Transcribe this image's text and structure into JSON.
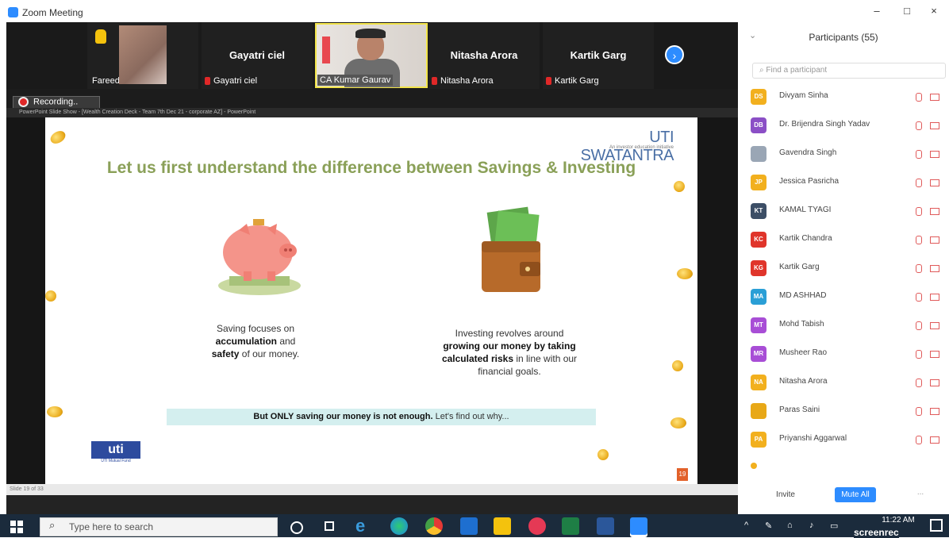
{
  "window": {
    "title": "Zoom Meeting",
    "minimize": "–",
    "maximize": "□",
    "close": "×"
  },
  "meeting": {
    "tiles": [
      {
        "label": "Fareed Fareed"
      },
      {
        "name": "Gayatri ciel",
        "label": "Gayatri ciel"
      },
      {
        "label": "CA Kumar Gaurav"
      },
      {
        "name": "Nitasha Arora",
        "label": "Nitasha Arora"
      },
      {
        "name": "Kartik Garg",
        "label": "Kartik Garg"
      }
    ],
    "next": "›",
    "recording": "Recording..",
    "ppt_bar": "PowerPoint Slide Show - [Wealth Creation Deck - Team 7th Dec 21 - corporate AZ] - PowerPoint",
    "status": "Slide 19 of 33"
  },
  "slide": {
    "brand": "UTI SWATANTRA",
    "brand_sub": "An investor education initiative",
    "title": "Let us first understand the difference between Savings & Investing",
    "saving_1": "Saving focuses on",
    "saving_2": "accumulation",
    "saving_3": "and",
    "saving_4": "safety",
    "saving_5": "of our money.",
    "invest_1": "Investing revolves around",
    "invest_2": "growing our money by taking",
    "invest_3": "calculated risks",
    "invest_4": "in line with our",
    "invest_5": "financial goals.",
    "banner_bold": "But ONLY saving our money is not enough.",
    "banner_rest": " Let's find out why...",
    "logo": "uti",
    "logo_sub": "UTI Mutual Fund",
    "page_number": "19"
  },
  "panel": {
    "title": "Participants (55)",
    "search_placeholder": "Find a participant",
    "participants": [
      {
        "initials": "DS",
        "name": "Divyam Sinha",
        "color": "#f2b01e"
      },
      {
        "initials": "DB",
        "name": "Dr. Brijendra Singh Yadav",
        "color": "#8b4fc6"
      },
      {
        "initials": "",
        "name": "Gavendra Singh",
        "color": "#9aa6b5"
      },
      {
        "initials": "JP",
        "name": "Jessica Pasricha",
        "color": "#f2b01e"
      },
      {
        "initials": "KT",
        "name": "KAMAL TYAGI",
        "color": "#3c4e66"
      },
      {
        "initials": "KC",
        "name": "Kartik Chandra",
        "color": "#e0352b"
      },
      {
        "initials": "KG",
        "name": "Kartik Garg",
        "color": "#e0352b"
      },
      {
        "initials": "MA",
        "name": "MD ASHHAD",
        "color": "#2a9fd6"
      },
      {
        "initials": "MT",
        "name": "Mohd Tabish",
        "color": "#a84ed6"
      },
      {
        "initials": "MR",
        "name": "Musheer Rao",
        "color": "#a84ed6"
      },
      {
        "initials": "NA",
        "name": "Nitasha Arora",
        "color": "#f2b01e"
      },
      {
        "initials": "",
        "name": "Paras Saini",
        "color": "#e8a817"
      },
      {
        "initials": "PA",
        "name": "Priyanshi Aggarwal",
        "color": "#f2b01e"
      }
    ],
    "invite": "Invite",
    "mute_all": "Mute All",
    "more": "..."
  },
  "taskbar": {
    "search_placeholder": "Type here to search",
    "time": "11:22 AM",
    "screenrec": "screenrec"
  }
}
